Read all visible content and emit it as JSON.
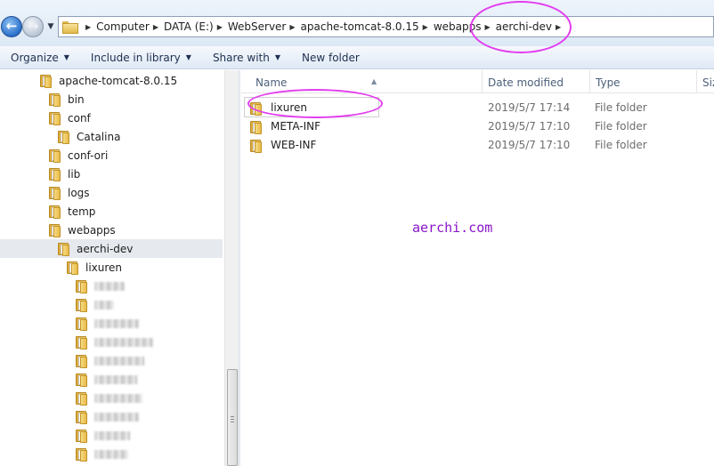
{
  "address": {
    "crumbs": [
      "Computer",
      "DATA (E:)",
      "WebServer",
      "apache-tomcat-8.0.15",
      "webapps",
      "aerchi-dev"
    ]
  },
  "toolbar": {
    "organize": "Organize",
    "include_in_library": "Include in library",
    "share_with": "Share with",
    "new_folder": "New folder"
  },
  "tree": [
    {
      "label": "apache-tomcat-8.0.15"
    },
    {
      "label": "bin"
    },
    {
      "label": "conf"
    },
    {
      "label": "Catalina"
    },
    {
      "label": "conf-ori"
    },
    {
      "label": "lib"
    },
    {
      "label": "logs"
    },
    {
      "label": "temp"
    },
    {
      "label": "webapps"
    },
    {
      "label": "aerchi-dev"
    },
    {
      "label": "lixuren"
    }
  ],
  "columns": {
    "name": "Name",
    "date_modified": "Date modified",
    "type": "Type",
    "size": "Siz"
  },
  "files": [
    {
      "name": "lixuren",
      "date": "2019/5/7 17:14",
      "type": "File folder"
    },
    {
      "name": "META-INF",
      "date": "2019/5/7 17:10",
      "type": "File folder"
    },
    {
      "name": "WEB-INF",
      "date": "2019/5/7 17:10",
      "type": "File folder"
    }
  ],
  "watermark": "aerchi.com",
  "colors": {
    "annotation": "#e33cf0",
    "watermark": "#8b16c9",
    "selection": "#e6e9ed"
  }
}
